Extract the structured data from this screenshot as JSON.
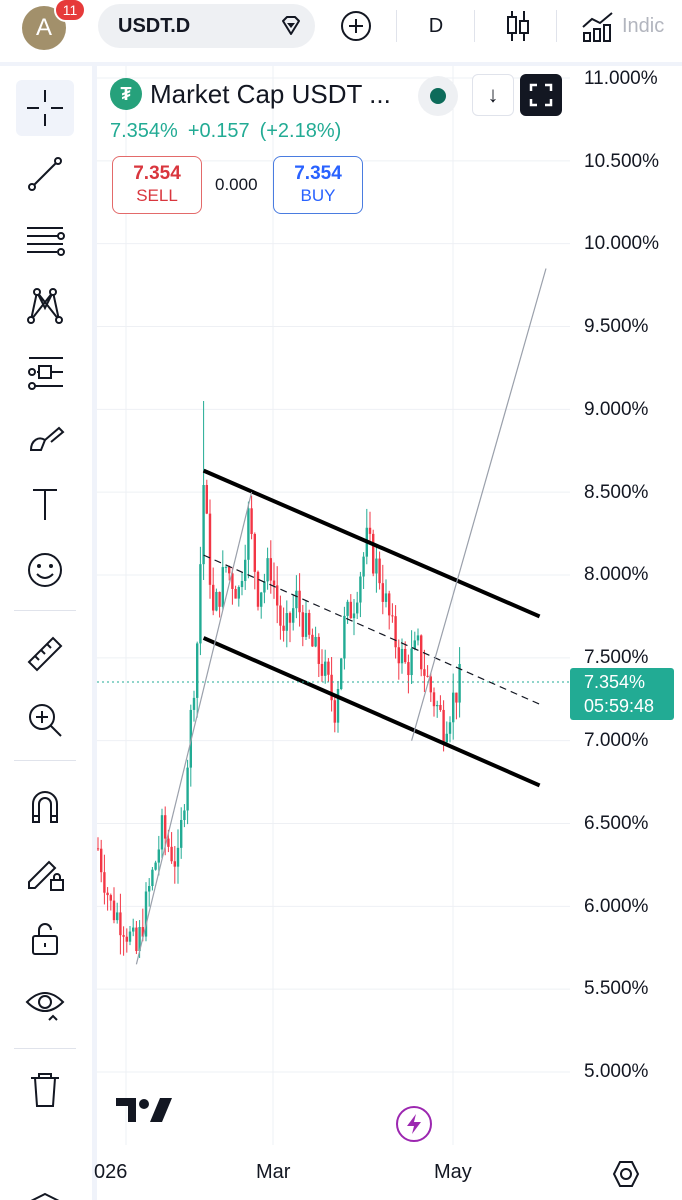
{
  "header": {
    "avatar_letter": "A",
    "notification_count": "11",
    "symbol": "USDT.D",
    "interval": "D",
    "indicators_label": "Indic"
  },
  "legend": {
    "title": "Market Cap USDT ...",
    "logo_glyph": "₮",
    "last_price": "7.354%",
    "change": "+0.157",
    "change_pct": "(+2.18%)",
    "sell_price": "7.354",
    "sell_label": "SELL",
    "spread": "0.000",
    "buy_price": "7.354",
    "buy_label": "BUY"
  },
  "price_axis": {
    "labels": [
      "11.000%",
      "10.500%",
      "10.000%",
      "9.500%",
      "9.000%",
      "8.500%",
      "8.000%",
      "7.500%",
      "7.000%",
      "6.500%",
      "6.000%",
      "5.500%",
      "5.000%"
    ],
    "current_price": "7.354%",
    "countdown": "05:59:48"
  },
  "time_axis": {
    "labels": [
      "026",
      "Mar",
      "May"
    ]
  },
  "chart_data": {
    "type": "candlestick",
    "ylim": [
      4.9,
      11.05
    ],
    "x_domain": [
      0,
      136
    ],
    "current_price": 7.354,
    "trendlines": [
      {
        "name": "channel-upper",
        "style": "solid",
        "from": [
          33,
          8.63
        ],
        "to": [
          138,
          7.75
        ]
      },
      {
        "name": "channel-lower",
        "style": "solid",
        "from": [
          33,
          7.62
        ],
        "to": [
          138,
          6.73
        ]
      },
      {
        "name": "channel-mid",
        "style": "dashed",
        "from": [
          33,
          8.12
        ],
        "to": [
          138,
          7.22
        ]
      },
      {
        "name": "projection",
        "style": "thin",
        "from": [
          98,
          7.0
        ],
        "to": [
          140,
          9.85
        ]
      },
      {
        "name": "rally-line",
        "style": "thin",
        "from": [
          12,
          5.65
        ],
        "to": [
          48,
          8.5
        ]
      }
    ]
  }
}
